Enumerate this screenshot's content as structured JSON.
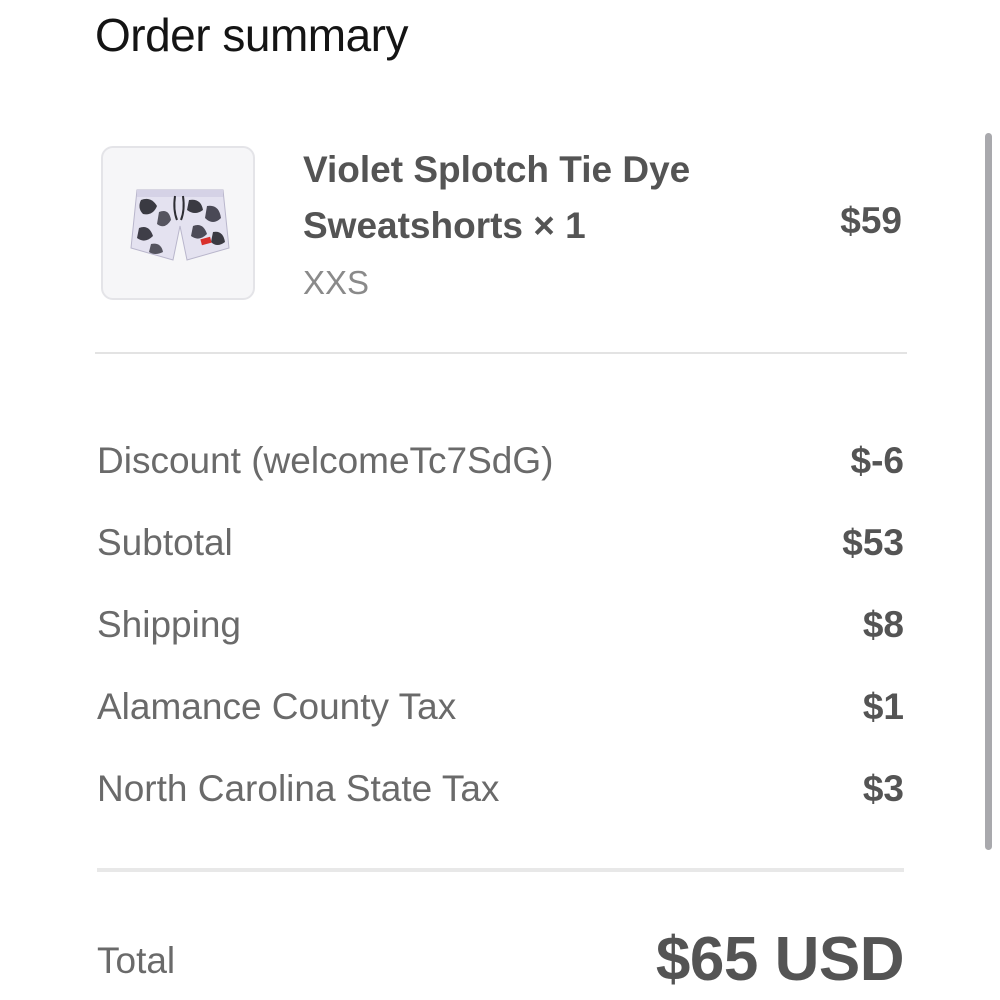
{
  "header": {
    "title": "Order summary"
  },
  "item": {
    "name": "Violet Splotch Tie Dye Sweatshorts × 1",
    "price": "$59",
    "variant": "XXS",
    "thumbnail": "tie-dye-shorts-image"
  },
  "summary": {
    "rows": [
      {
        "label": "Discount (welcomeTc7SdG)",
        "value": "$-6"
      },
      {
        "label": "Subtotal",
        "value": "$53"
      },
      {
        "label": "Shipping",
        "value": "$8"
      },
      {
        "label": "Alamance County Tax",
        "value": "$1"
      },
      {
        "label": "North Carolina State Tax",
        "value": "$3"
      }
    ]
  },
  "total": {
    "label": "Total",
    "value": "$65 USD"
  }
}
